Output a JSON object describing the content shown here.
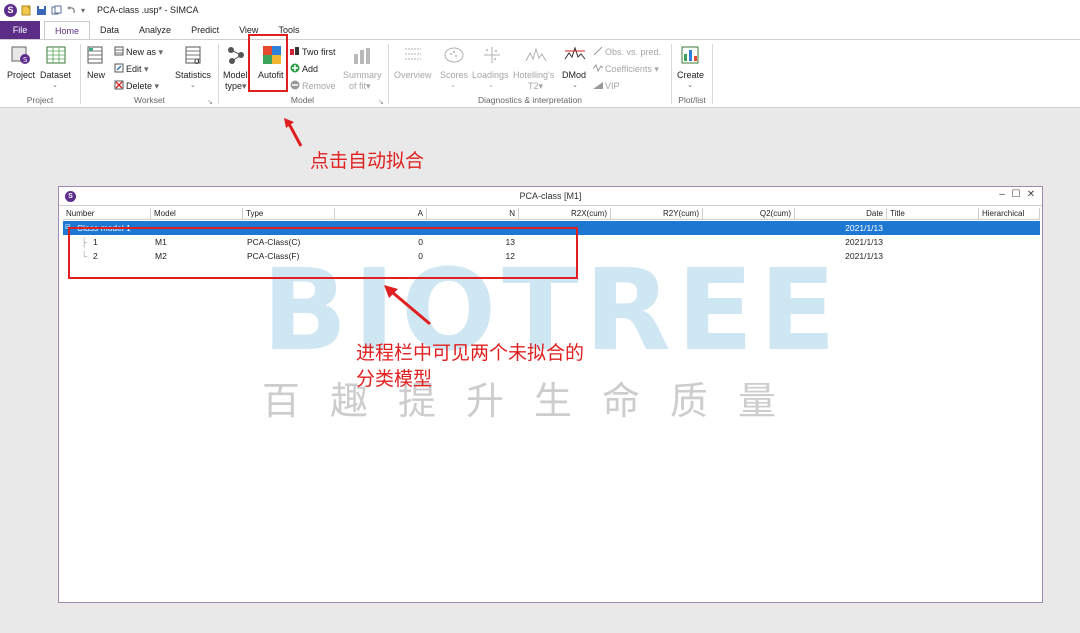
{
  "window": {
    "title": "PCA-class .usp* - SIMCA",
    "app_logo": "S"
  },
  "tabs": [
    "File",
    "Home",
    "Data",
    "Analyze",
    "Predict",
    "View",
    "Tools"
  ],
  "ribbon": {
    "project_group": {
      "project": "Project",
      "dataset": "Dataset",
      "label": "Project"
    },
    "workset_group": {
      "new": "New",
      "new_as": "New as",
      "edit": "Edit",
      "delete": "Delete",
      "statistics": "Statistics",
      "label": "Workset"
    },
    "model_group": {
      "model_type_1": "Model",
      "model_type_2": "type",
      "autofit": "Autofit",
      "two_first": "Two first",
      "add": "Add",
      "remove": "Remove",
      "summary_1": "Summary",
      "summary_2": "of fit",
      "label": "Model"
    },
    "diag_group": {
      "overview": "Overview",
      "scores": "Scores",
      "loadings": "Loadings",
      "hotellings_1": "Hotelling's",
      "hotellings_2": "T2",
      "dmod": "DMod",
      "obs_vs_pred": "Obs. vs. pred.",
      "coefficients": "Coefficients",
      "vip": "VIP",
      "label": "Diagnostics & interpretation"
    },
    "plotlist_group": {
      "create": "Create",
      "label": "Plot/list"
    }
  },
  "annotations": {
    "autofit_note": "点击自动拟合",
    "progress_note_1": "进程栏中可见两个未拟合的",
    "progress_note_2": "分类模型"
  },
  "document": {
    "title": "PCA-class  [M1]",
    "logo": "S",
    "columns": [
      "Number",
      "Model",
      "Type",
      "A",
      "N",
      "R2X(cum)",
      "R2Y(cum)",
      "Q2(cum)",
      "Date",
      "Title",
      "Hierarchical"
    ],
    "group_row": {
      "name": "Class model 1",
      "date": "2021/1/13"
    },
    "rows": [
      {
        "number": "1",
        "model": "M1",
        "type": "PCA-Class(C)",
        "a": "0",
        "n": "13",
        "date": "2021/1/13"
      },
      {
        "number": "2",
        "model": "M2",
        "type": "PCA-Class(F)",
        "a": "0",
        "n": "12",
        "date": "2021/1/13"
      }
    ]
  },
  "watermark": {
    "brand": "BIOTREE",
    "slogan": "百趣提升生命质量"
  },
  "colors": {
    "accent": "#5b2d86",
    "selection": "#1e78d2",
    "annotation": "#e02020"
  }
}
